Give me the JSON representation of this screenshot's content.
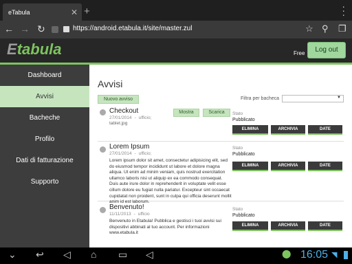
{
  "browser": {
    "tab_title": "eTabula",
    "url": "https://android.etabula.it/site/master.zul"
  },
  "app": {
    "logo_e": "E",
    "logo_rest": "tabula",
    "plan": "Free",
    "logout_label": "Log out"
  },
  "sidebar": {
    "items": [
      {
        "label": "Dashboard"
      },
      {
        "label": "Avvisi"
      },
      {
        "label": "Bacheche"
      },
      {
        "label": "Profilo"
      },
      {
        "label": "Dati di fatturazione"
      },
      {
        "label": "Supporto"
      }
    ]
  },
  "main": {
    "title": "Avvisi",
    "new_label": "Nuovo avviso",
    "filter_label": "Filtra per bacheca",
    "filter_value": "",
    "stato_label": "Stato",
    "btn_elimina": "ELIMINA",
    "btn_archivia": "ARCHIVIA",
    "btn_date": "DATE",
    "btn_mostra": "Mostra",
    "btn_scarica": "Scarica",
    "items": [
      {
        "title": "Checkout",
        "date": "27/01/2014",
        "dash": "-",
        "board": "ufficio;",
        "file": "tablet.jpg",
        "body": "",
        "stato": "Pubblicato"
      },
      {
        "title": "Lorem Ipsum",
        "date": "27/01/2014",
        "dash": "-",
        "board": "ufficio;",
        "file": "",
        "body": "Lorem ipsum dolor sit amet, consectetur adipisicing elit, sed do eiusmod tempor incididunt ut labore et dolore magna aliqua. Ut enim ad minim veniam, quis nostrud exercitation ullamco laboris nisi ut aliquip ex ea commodo consequat. Duis aute irure dolor in reprehenderit in voluptate velit esse cillum dolore eu fugiat nulla pariatur. Excepteur sint occaecat cupidatat non proident, sunt in culpa qui officia deserunt mollit anim id est laborum.",
        "stato": "Pubblicato"
      },
      {
        "title": "Benvenuto!",
        "date": "11/11/2013",
        "dash": "-",
        "board": "ufficio",
        "file": "",
        "body": "Benvenuto in Etabula! Pubblica e gestisci i tuoi avvisi sui dispositivi abbinati al tuo account. Per informazioni www.etabula.it",
        "stato": "Pubblicato"
      }
    ]
  },
  "system": {
    "clock": "16:05"
  }
}
